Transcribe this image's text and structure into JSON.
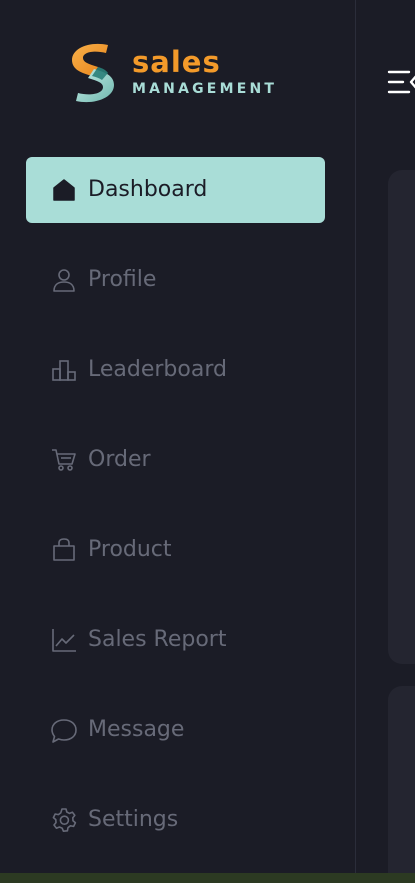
{
  "brand": {
    "word": "sales",
    "subtitle": "MANAGEMENT",
    "colors": {
      "orange": "#f39a2a",
      "teal": "#a9ddd7"
    }
  },
  "nav": {
    "items": [
      {
        "label": "Dashboard",
        "icon": "home-icon",
        "active": true
      },
      {
        "label": "Profile",
        "icon": "user-icon",
        "active": false
      },
      {
        "label": "Leaderboard",
        "icon": "leaderboard-icon",
        "active": false
      },
      {
        "label": "Order",
        "icon": "cart-icon",
        "active": false
      },
      {
        "label": "Product",
        "icon": "shopping-bag-icon",
        "active": false
      },
      {
        "label": "Sales Report",
        "icon": "line-chart-icon",
        "active": false
      },
      {
        "label": "Message",
        "icon": "message-icon",
        "active": false
      },
      {
        "label": "Settings",
        "icon": "gear-icon",
        "active": false
      }
    ]
  },
  "header": {
    "toggle_icon": "menu-collapse-icon"
  },
  "colors": {
    "background": "#1b1c26",
    "active_item": "#a9ddd7",
    "inactive_text": "#676a78"
  }
}
